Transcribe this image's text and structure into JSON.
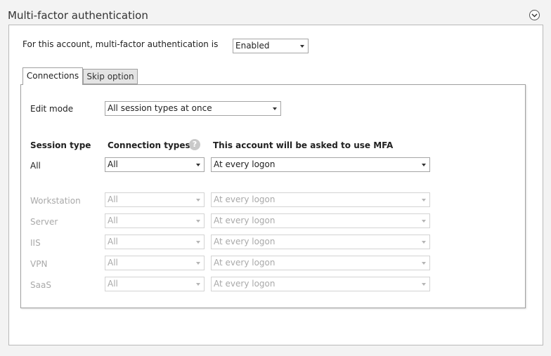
{
  "section": {
    "title": "Multi-factor authentication",
    "collapse_icon": "chevron-down-circle-icon"
  },
  "account_mfa": {
    "label": "For this account, multi-factor authentication is",
    "value": "Enabled"
  },
  "tabs": [
    {
      "label": "Connections",
      "active": true
    },
    {
      "label": "Skip option",
      "active": false
    }
  ],
  "edit_mode": {
    "label": "Edit mode",
    "value": "All session types at once"
  },
  "table": {
    "headers": {
      "session_type": "Session type",
      "connection_types": "Connection types",
      "ask_mfa": "This account will be asked to use MFA"
    },
    "help_icon": "question-icon",
    "all_row": {
      "session": "All",
      "connection": "All",
      "mfa": "At every logon"
    },
    "rows": [
      {
        "session": "Workstation",
        "connection": "All",
        "mfa": "At every logon",
        "disabled": true
      },
      {
        "session": "Server",
        "connection": "All",
        "mfa": "At every logon",
        "disabled": true
      },
      {
        "session": "IIS",
        "connection": "All",
        "mfa": "At every logon",
        "disabled": true
      },
      {
        "session": "VPN",
        "connection": "All",
        "mfa": "At every logon",
        "disabled": true
      },
      {
        "session": "SaaS",
        "connection": "All",
        "mfa": "At every logon",
        "disabled": true
      }
    ]
  },
  "colors": {
    "background": "#f3f3f3",
    "panel": "#ffffff",
    "border": "#a0a0a0",
    "disabled_text": "#a9a9a9"
  }
}
